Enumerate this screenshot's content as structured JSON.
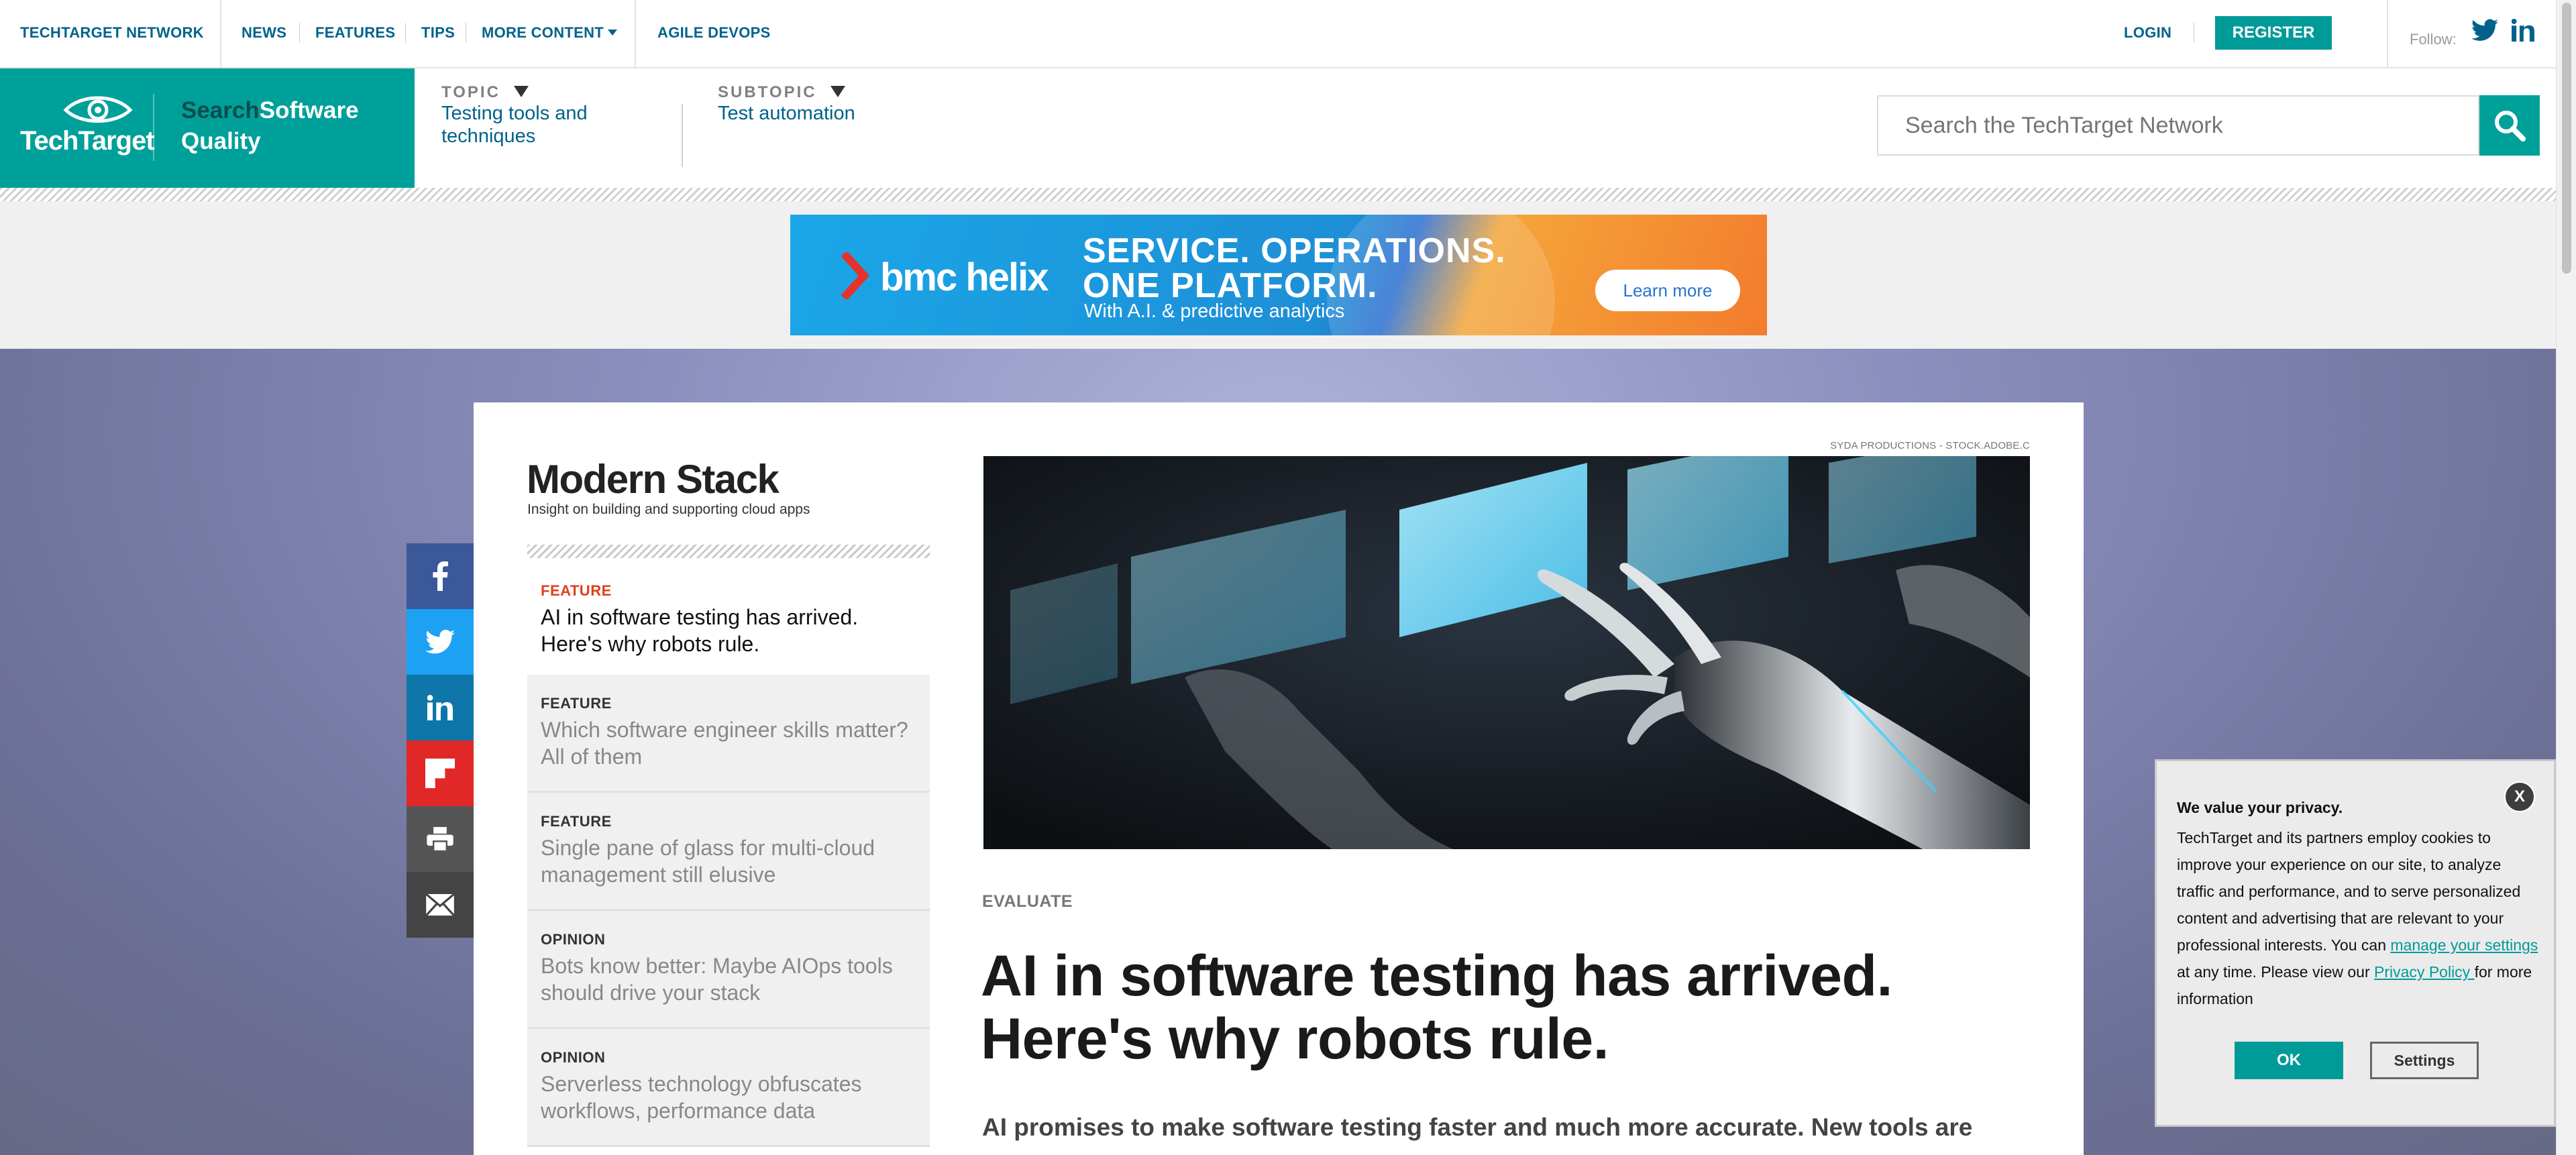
{
  "topnav": {
    "items": [
      "TECHTARGET NETWORK",
      "NEWS",
      "FEATURES",
      "TIPS",
      "MORE CONTENT",
      "AGILE DEVOPS"
    ],
    "login": "LOGIN",
    "register": "REGISTER",
    "follow": "Follow:"
  },
  "brand": {
    "logo": "TechTarget",
    "site_prefix": "Search",
    "site_name_1": "Software",
    "site_name_2": "Quality"
  },
  "topic": {
    "label": "TOPIC",
    "value_line1": "Testing tools and",
    "value_line2": "techniques"
  },
  "subtopic": {
    "label": "SUBTOPIC",
    "value": "Test automation"
  },
  "search": {
    "placeholder": "Search the TechTarget Network"
  },
  "ad": {
    "brand": "bmc helix",
    "headline_line1": "SERVICE. OPERATIONS.",
    "headline_line2": "ONE PLATFORM.",
    "subline": "With A.I. & predictive analytics",
    "cta": "Learn more"
  },
  "share": {
    "icons": [
      "facebook-icon",
      "twitter-icon",
      "linkedin-icon",
      "flipboard-icon",
      "print-icon",
      "email-icon"
    ],
    "colors": [
      "#3b5998",
      "#1da1f2",
      "#0e76a8",
      "#e12828",
      "#555555",
      "#444444"
    ]
  },
  "stack": {
    "title": "Modern Stack",
    "subtitle": "Insight on building and supporting cloud apps",
    "items": [
      {
        "type": "FEATURE",
        "headline": "AI in software testing has arrived. Here's why robots rule."
      },
      {
        "type": "FEATURE",
        "headline": "Which software engineer skills matter? All of them"
      },
      {
        "type": "FEATURE",
        "headline": "Single pane of glass for multi-cloud management still elusive"
      },
      {
        "type": "OPINION",
        "headline": "Bots know better: Maybe AIOps tools should drive your stack"
      },
      {
        "type": "OPINION",
        "headline": "Serverless technology obfuscates workflows, performance data"
      }
    ]
  },
  "article": {
    "image_credit": "SYDA PRODUCTIONS - STOCK.ADOBE.C",
    "category": "EVALUATE",
    "title": "AI in software testing has arrived. Here's why robots rule.",
    "lead": "AI promises to make software testing faster and much more accurate. New tools are"
  },
  "privacy": {
    "close": "X",
    "heading": "We value your privacy.",
    "body_1": "TechTarget and its partners employ cookies to improve your experience on our site, to analyze traffic and performance, and to serve personalized content and advertising that are relevant to your professional interests. You can ",
    "link_settings": "manage your settings",
    "body_2": " at any time. Please view our ",
    "link_policy": "Privacy Policy ",
    "body_3": "for more information",
    "ok": "OK",
    "settings": "Settings"
  },
  "colors": {
    "teal": "#00a09a",
    "link": "#00628b",
    "feature_red": "#e0401e"
  }
}
